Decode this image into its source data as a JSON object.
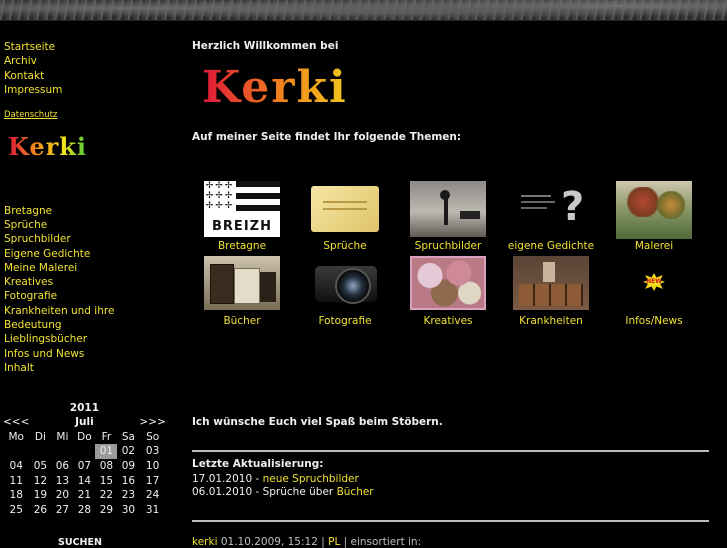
{
  "nav": {
    "main": [
      "Startseite",
      "Archiv",
      "Kontakt",
      "Impressum"
    ],
    "datenschutz": "Datenschutz",
    "logo_small": "Kerki",
    "sections": [
      "Bretagne",
      "Sprüche",
      "Spruchbilder",
      "Eigene Gedichte",
      "Meine Malerei",
      "Kreatives",
      "Fotografie",
      "Krankheiten und ihre Bedeutung",
      "Lieblingsbücher",
      "Infos und News",
      "Inhalt"
    ]
  },
  "calendar": {
    "year": "2011",
    "month": "Juli",
    "prev": "<<<",
    "next": ">>>",
    "weekdays": [
      "Mo",
      "Di",
      "Mi",
      "Do",
      "Fr",
      "Sa",
      "So"
    ],
    "weeks": [
      [
        "",
        "",
        "",
        "",
        "01",
        "02",
        "03"
      ],
      [
        "04",
        "05",
        "06",
        "07",
        "08",
        "09",
        "10"
      ],
      [
        "11",
        "12",
        "13",
        "14",
        "15",
        "16",
        "17"
      ],
      [
        "18",
        "19",
        "20",
        "21",
        "22",
        "23",
        "24"
      ],
      [
        "25",
        "26",
        "27",
        "28",
        "29",
        "30",
        "31"
      ]
    ],
    "selected_day": "01",
    "search_label": "SUCHEN"
  },
  "main": {
    "welcome": "Herzlich Willkommen bei",
    "logo": "Kerki",
    "topics_heading": "Auf meiner Seite findet Ihr folgende Themen:",
    "enjoy": "Ich wünsche Euch viel Spaß beim Stöbern.",
    "update_heading": "Letzte Aktualisierung:",
    "updates": [
      {
        "date": "17.01.2010 - ",
        "link": "neue Spruchbilder",
        "text": ""
      },
      {
        "date": "06.01.2010 - ",
        "link": "Bücher",
        "text": "Sprüche über "
      }
    ],
    "footer": {
      "author": "kerki",
      "datetime": "01.10.2009, 15:12",
      "sep": " | ",
      "pl": "PL",
      "rest": " | einsortiert in:"
    }
  },
  "topics": [
    {
      "label": "Bretagne",
      "icon": "breizh-flag-icon",
      "thumb_text": "BREIZH"
    },
    {
      "label": "Sprüche",
      "icon": "parchment-scroll-icon",
      "thumb_text": ""
    },
    {
      "label": "Spruchbilder",
      "icon": "silhouette-picture-icon",
      "thumb_text": ""
    },
    {
      "label": "eigene Gedichte",
      "icon": "question-mark-icon",
      "thumb_text": ""
    },
    {
      "label": "Malerei",
      "icon": "painting-icon",
      "thumb_text": ""
    },
    {
      "label": "Bücher",
      "icon": "books-icon",
      "thumb_text": ""
    },
    {
      "label": "Fotografie",
      "icon": "camera-icon",
      "thumb_text": ""
    },
    {
      "label": "Kreatives",
      "icon": "yarn-icon",
      "thumb_text": ""
    },
    {
      "label": "Krankheiten",
      "icon": "apothecary-cabinet-icon",
      "thumb_text": ""
    },
    {
      "label": "Infos/News",
      "icon": "new-starburst-icon",
      "thumb_text": "NEW"
    }
  ]
}
